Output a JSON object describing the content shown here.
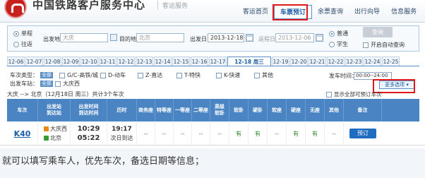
{
  "header": {
    "site_title": "中国铁路客户服务中心",
    "site_sub": "客运服务",
    "nav": [
      "客运首页",
      "车票预订",
      "余票查询",
      "出行向导",
      "信息服务"
    ]
  },
  "search": {
    "trip_single": "单程",
    "trip_round": "往返",
    "from_label": "出发地",
    "from_value": "大庆",
    "to_label": "目的地",
    "to_value": "北京",
    "date_label": "出发日",
    "date_value": "2013-12-18",
    "return_label": "返程日",
    "return_value": "2013-12-06",
    "type_normal": "普通",
    "type_student": "学生",
    "query_button": "查询",
    "auto_query": "开启自动查询"
  },
  "dates": [
    "12-06",
    "12-07",
    "12-08",
    "12-09",
    "12-10",
    "12-11",
    "12-12",
    "12-13",
    "12-14",
    "12-15",
    "12-16",
    "12-17",
    "12-18 周三",
    "12-19",
    "12-20",
    "12-21",
    "12-22",
    "12-23",
    "12-24",
    "12-25"
  ],
  "filters": {
    "type_label": "车次类型：",
    "all_tag": "全部",
    "types": [
      "G/C-高铁/城",
      "D-动车",
      "Z-直达",
      "T-特快",
      "K-快速",
      "其他"
    ],
    "station_label": "出发车站：",
    "station_all": "全部",
    "station_name": "大庆西",
    "time_label": "发车时间：",
    "time_value": "00:00--24:00",
    "more_options": "更多选项"
  },
  "result": {
    "route": "大庆 --> 北京（12月18日 周三）共计3个车次",
    "show_all": "显示全部可预订车次"
  },
  "table": {
    "headers": [
      "车次",
      "出发站\n到达站",
      "出发时间\n到达时间",
      "历时",
      "商务座",
      "特等座",
      "一等座",
      "二等座",
      "高级\n软卧",
      "软卧",
      "硬卧",
      "软座",
      "硬座",
      "无座",
      "其他",
      "备注"
    ],
    "row": {
      "train": "K40",
      "from_station": "大庆西",
      "to_station": "北京",
      "depart": "10:29",
      "arrive": "05:22",
      "duration": "19:17",
      "duration_note": "次日到达",
      "seats": [
        "--",
        "--",
        "--",
        "--",
        "--",
        "有",
        "有",
        "--",
        "有",
        "有",
        "--"
      ],
      "book_button": "预订"
    }
  },
  "caption": "就可以填写乘车人，优先车次，备选日期等信息；",
  "colors": {
    "accent": "#4a84c2",
    "highlight": "#e0191d",
    "brand_red": "#c8201c"
  }
}
